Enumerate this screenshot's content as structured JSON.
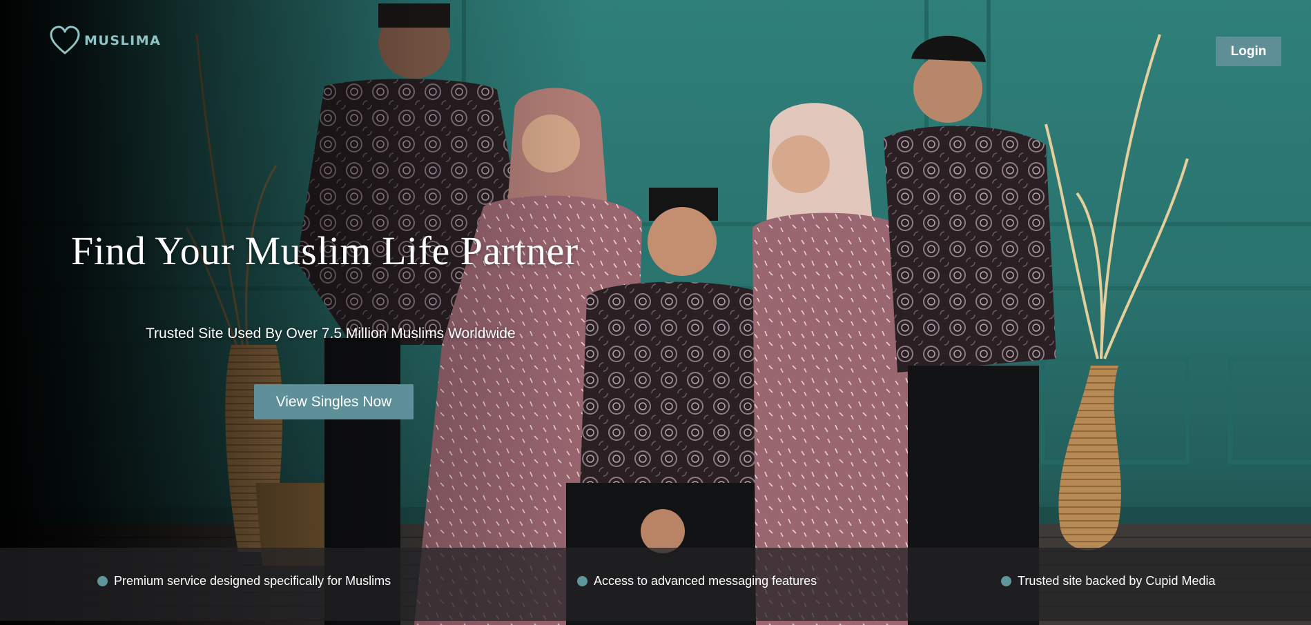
{
  "header": {
    "logo_text": "MUSLIMA",
    "login_label": "Login"
  },
  "hero": {
    "headline": "Find Your Muslim Life Partner",
    "subheadline": "Trusted Site Used By Over 7.5 Million Muslims Worldwide",
    "cta_label": "View Singles Now"
  },
  "features": [
    {
      "text": "Premium service designed specifically for Muslims",
      "icon": "bullet-dot-icon"
    },
    {
      "text": "Access to advanced messaging features",
      "icon": "bullet-dot-icon"
    },
    {
      "text": "Trusted site backed by Cupid Media",
      "icon": "bullet-dot-icon"
    }
  ],
  "colors": {
    "brand_teal": "#8fc3c4",
    "button_teal": "#5d9098",
    "wall_teal": "#2f7f7a",
    "batik_dark": "#2a2024",
    "dress_mauve": "#9a6670"
  }
}
